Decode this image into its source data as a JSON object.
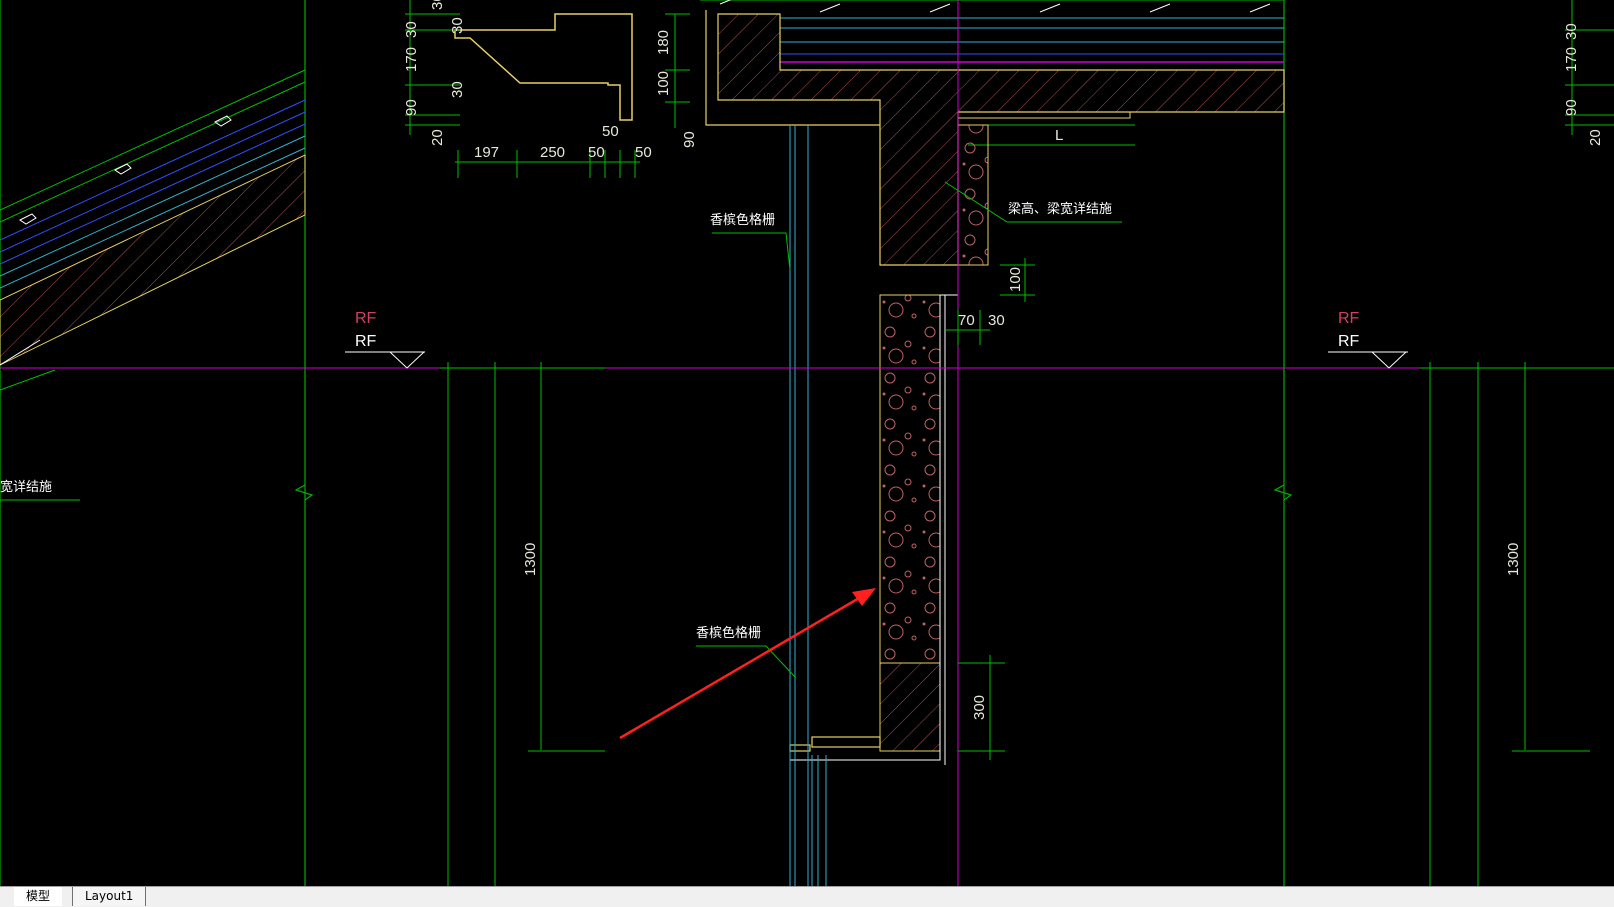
{
  "tabs": [
    {
      "label": "模型",
      "active": true
    },
    {
      "label": "Layout1",
      "active": false
    }
  ],
  "annotations": {
    "level_tag_1": "RF",
    "level_tag_2": "RF",
    "level_tag_3": "RF",
    "level_tag_4": "RF",
    "note_rail_upper": "香槟色格栅",
    "note_rail_lower": "香槟色格栅",
    "note_beam": "梁高、梁宽详结施",
    "note_left_edge": "宽详结施",
    "label_L": "L"
  },
  "dimensions": {
    "profile_top": "30",
    "profile_30a": "30",
    "profile_170": "170",
    "profile_30b": "30",
    "profile_90": "90",
    "profile_20": "20",
    "profile_197": "197",
    "profile_250": "250",
    "profile_50a": "50",
    "profile_50b": "50",
    "profile_50c": "50",
    "profile_180": "180",
    "profile_100": "100",
    "profile_90b": "90",
    "beam_100": "100",
    "beam_70": "70",
    "beam_30": "30",
    "wall_1300_left": "1300",
    "wall_1300_right": "1300",
    "wall_300": "300",
    "right_30": "30",
    "right_170": "170",
    "right_90": "90",
    "right_20": "20"
  },
  "colors": {
    "background": "#000000",
    "green": "#00c000",
    "yellow": "#e8d060",
    "hatch": "#c06060",
    "magenta": "#d000d0",
    "cyan": "#30b0d0",
    "blue": "#3050ff",
    "white": "#ffffff",
    "red_arrow": "#ff2020"
  }
}
